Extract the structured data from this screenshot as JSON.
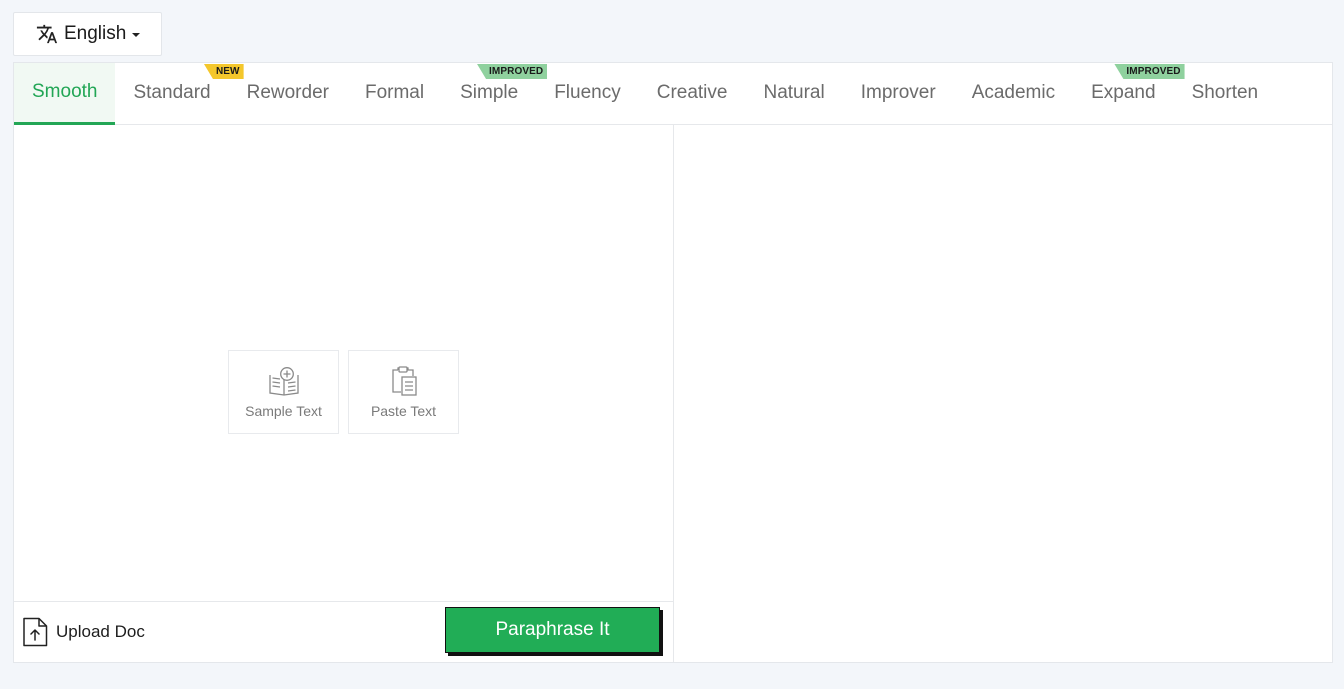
{
  "language": {
    "selected": "English",
    "icon": "translate-icon"
  },
  "tabs": [
    {
      "label": "Smooth",
      "active": true
    },
    {
      "label": "Standard",
      "badge": "NEW"
    },
    {
      "label": "Reworder"
    },
    {
      "label": "Formal"
    },
    {
      "label": "Simple",
      "badge": "IMPROVED"
    },
    {
      "label": "Fluency"
    },
    {
      "label": "Creative"
    },
    {
      "label": "Natural"
    },
    {
      "label": "Improver"
    },
    {
      "label": "Academic"
    },
    {
      "label": "Expand",
      "badge": "IMPROVED"
    },
    {
      "label": "Shorten"
    }
  ],
  "input": {
    "sample_label": "Sample Text",
    "paste_label": "Paste Text"
  },
  "footer": {
    "upload_label": "Upload Doc",
    "paraphrase_label": "Paraphrase It"
  },
  "colors": {
    "accent": "#22a655",
    "button": "#21ad56",
    "badge_new": "#f4c72c",
    "badge_improved": "#8fd19e",
    "background": "#f3f6fa"
  }
}
